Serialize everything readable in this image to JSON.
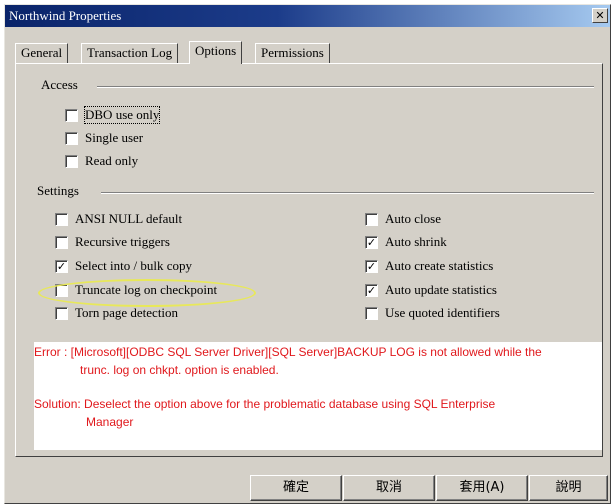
{
  "window": {
    "title": "Northwind Properties",
    "close_glyph": "✕"
  },
  "tabs": [
    {
      "label": "General",
      "active": false
    },
    {
      "label": "Transaction Log",
      "active": false
    },
    {
      "label": "Options",
      "active": true
    },
    {
      "label": "Permissions",
      "active": false
    }
  ],
  "access": {
    "label": "Access",
    "options": [
      {
        "label": "DBO use only",
        "checked": false
      },
      {
        "label": "Single user",
        "checked": false
      },
      {
        "label": "Read only",
        "checked": false
      }
    ]
  },
  "settings": {
    "label": "Settings",
    "left": [
      {
        "label": "ANSI NULL default",
        "checked": false
      },
      {
        "label": "Recursive triggers",
        "checked": false
      },
      {
        "label": "Select into / bulk copy",
        "checked": true
      },
      {
        "label": "Truncate log on checkpoint",
        "checked": false
      },
      {
        "label": "Torn page detection",
        "checked": false
      }
    ],
    "right": [
      {
        "label": "Auto close",
        "checked": false
      },
      {
        "label": "Auto shrink",
        "checked": true
      },
      {
        "label": "Auto create statistics",
        "checked": true
      },
      {
        "label": "Auto update statistics",
        "checked": true
      },
      {
        "label": "Use quoted identifiers",
        "checked": false
      }
    ]
  },
  "annotation": {
    "error_line1": "Error : [Microsoft][ODBC SQL Server Driver][SQL Server]BACKUP LOG is not allowed while the",
    "error_line2": "trunc. log on chkpt. option is enabled.",
    "solution_line1": "Solution: Deselect the option above for the problematic database using SQL Enterprise",
    "solution_line2": "Manager",
    "color": "#e0181c"
  },
  "buttons": {
    "ok": "確定",
    "cancel": "取消",
    "apply": "套用(A)",
    "help": "說明"
  }
}
